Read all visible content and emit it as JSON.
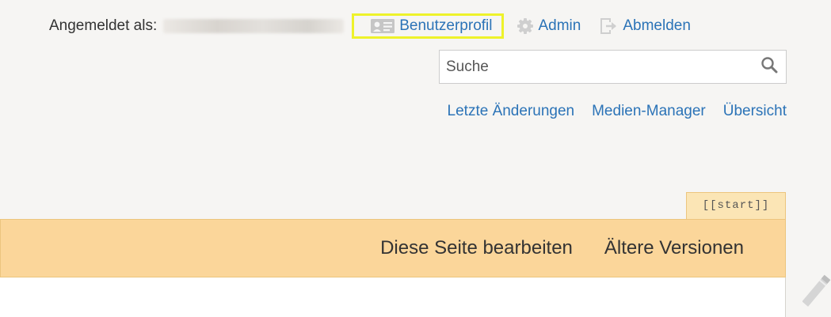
{
  "user_bar": {
    "logged_in_label": "Angemeldet als:",
    "profile_link": "Benutzerprofil",
    "admin_link": "Admin",
    "logout_link": "Abmelden",
    "profile_icon": "profile-card-icon",
    "admin_icon": "gear-icon",
    "logout_icon": "logout-arrow-icon"
  },
  "search": {
    "placeholder": "Suche",
    "button_icon": "search-icon"
  },
  "site_tools": {
    "recent_changes": "Letzte Änderungen",
    "media_manager": "Medien-Manager",
    "sitemap": "Übersicht"
  },
  "page": {
    "id_badge": "[[start]]"
  },
  "page_tools": {
    "edit": "Diese Seite bearbeiten",
    "revisions": "Ältere Versionen",
    "edit_icon": "pencil-icon"
  },
  "colors": {
    "link": "#2b73b7",
    "highlight_border": "#eef22a",
    "page_tools_bg": "#fbd69a",
    "page_background": "#f6f5f3"
  }
}
